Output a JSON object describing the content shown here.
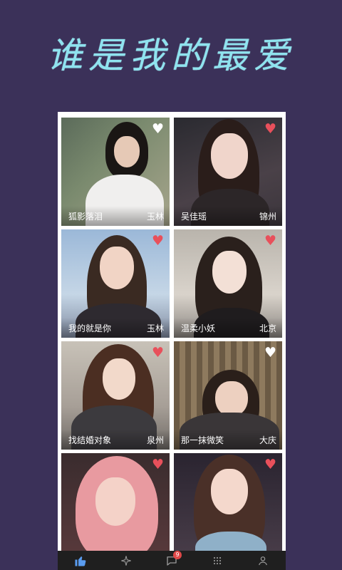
{
  "headline": "谁是我的最爱",
  "colors": {
    "background": "#3b3159",
    "headline": "#8fe3ef",
    "heart_liked": "#e8505b",
    "heart_unliked": "#ffffff",
    "tabbar": "#1f1f1f",
    "tab_active": "#5a9cf0"
  },
  "cards": [
    {
      "name": "狐影落泪",
      "city": "玉林",
      "liked": false,
      "heart": "♥"
    },
    {
      "name": "吴佳瑶",
      "city": "锦州",
      "liked": true,
      "heart": "♥"
    },
    {
      "name": "我的就是你",
      "city": "玉林",
      "liked": true,
      "heart": "♥"
    },
    {
      "name": "温柔小妖",
      "city": "北京",
      "liked": true,
      "heart": "♥"
    },
    {
      "name": "找结婚对象",
      "city": "泉州",
      "liked": true,
      "heart": "♥"
    },
    {
      "name": "那一抹微笑",
      "city": "大庆",
      "liked": false,
      "heart": "♥"
    },
    {
      "name": "",
      "city": "",
      "liked": true,
      "heart": "♥"
    },
    {
      "name": "",
      "city": "",
      "liked": true,
      "heart": "♥"
    }
  ],
  "tabbar": {
    "tabs": [
      {
        "icon": "thumbs-up-icon",
        "active": true
      },
      {
        "icon": "sparkle-icon",
        "active": false
      },
      {
        "icon": "chat-bubble-icon",
        "active": false,
        "badge": "9"
      },
      {
        "icon": "dots-grid-icon",
        "active": false
      },
      {
        "icon": "person-icon",
        "active": false
      }
    ]
  }
}
